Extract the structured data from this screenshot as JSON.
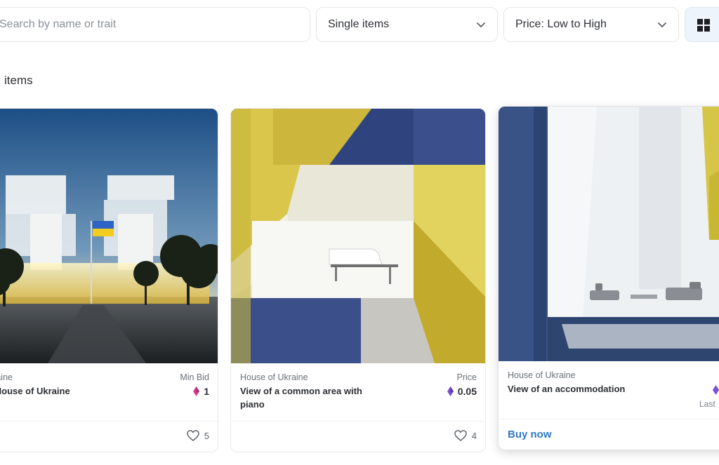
{
  "toolbar": {
    "search_placeholder": "Search by name or trait",
    "type_filter": "Single items",
    "sort": "Price: Low to High",
    "view_icon": "grid-icon"
  },
  "results": {
    "count_label": "items"
  },
  "colors": {
    "accent": "#2e79c4",
    "eth": "#7b4fd6",
    "eth_alt": "#d43f8a"
  },
  "cards": [
    {
      "collection": "of Ukraine",
      "title": "rtual House of Ukraine",
      "price_label": "Min Bid",
      "price": "1",
      "likes": "5",
      "image": "building-with-ukraine-flag"
    },
    {
      "collection": "House of Ukraine",
      "title": "View of a common area with piano",
      "price_label": "Price",
      "price": "0.05",
      "likes": "4",
      "image": "hall-with-grand-piano"
    },
    {
      "collection": "House of Ukraine",
      "title": "View of an accommodation",
      "action": "Buy now",
      "last_label": "Last",
      "image": "lounge-interior"
    }
  ]
}
